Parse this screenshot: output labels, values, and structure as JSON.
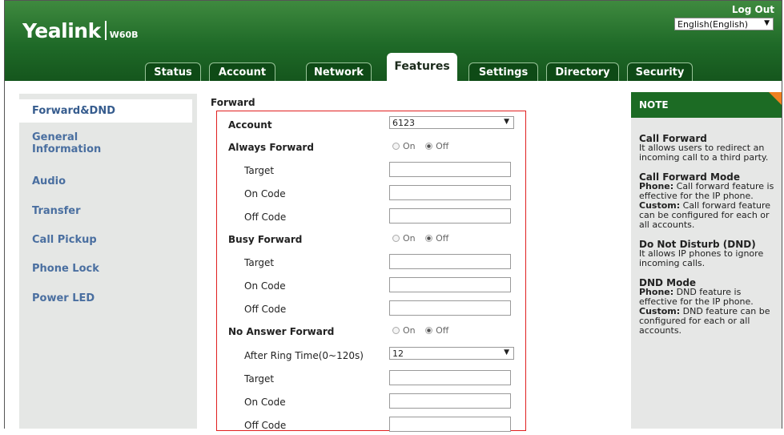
{
  "header": {
    "logo_brand": "Yealink",
    "logo_model": "W60B",
    "logout": "Log Out",
    "language": "English(English)",
    "language_arrow": "▼"
  },
  "tabs": [
    {
      "label": "Status"
    },
    {
      "label": "Account"
    },
    {
      "label": "Network"
    },
    {
      "label": "Features"
    },
    {
      "label": "Settings"
    },
    {
      "label": "Directory"
    },
    {
      "label": "Security"
    }
  ],
  "sidebar": {
    "items": [
      {
        "label": "Forward&DND"
      },
      {
        "label": "General Information"
      },
      {
        "label": "Audio"
      },
      {
        "label": "Transfer"
      },
      {
        "label": "Call Pickup"
      },
      {
        "label": "Phone Lock"
      },
      {
        "label": "Power LED"
      }
    ]
  },
  "forward": {
    "section_title": "Forward",
    "account_label": "Account",
    "account_value": "6123",
    "always_forward": "Always Forward",
    "busy_forward": "Busy Forward",
    "no_answer_forward": "No Answer Forward",
    "target": "Target",
    "on_code": "On Code",
    "off_code": "Off Code",
    "on": "On",
    "off": "Off",
    "after_ring_label": "After Ring Time(0~120s)",
    "after_ring_value": "12",
    "select_arrow": "▼"
  },
  "note": {
    "title": "NOTE",
    "call_forward_title": "Call Forward",
    "call_forward_text": "It allows users to redirect an incoming call to a third party.",
    "cf_mode_title": "Call Forward Mode",
    "phone_label": "Phone:",
    "cf_phone_text": "Call forward feature is effective for the IP phone.",
    "custom_label": "Custom:",
    "cf_custom_text": "Call forward feature can be configured for each or all accounts.",
    "dnd_title": "Do Not Disturb (DND)",
    "dnd_text": "It allows IP phones to ignore incoming calls.",
    "dnd_mode_title": "DND Mode",
    "dnd_phone_text": "DND feature is effective for the IP phone.",
    "dnd_custom_text": "DND feature can be configured for each or all accounts."
  }
}
